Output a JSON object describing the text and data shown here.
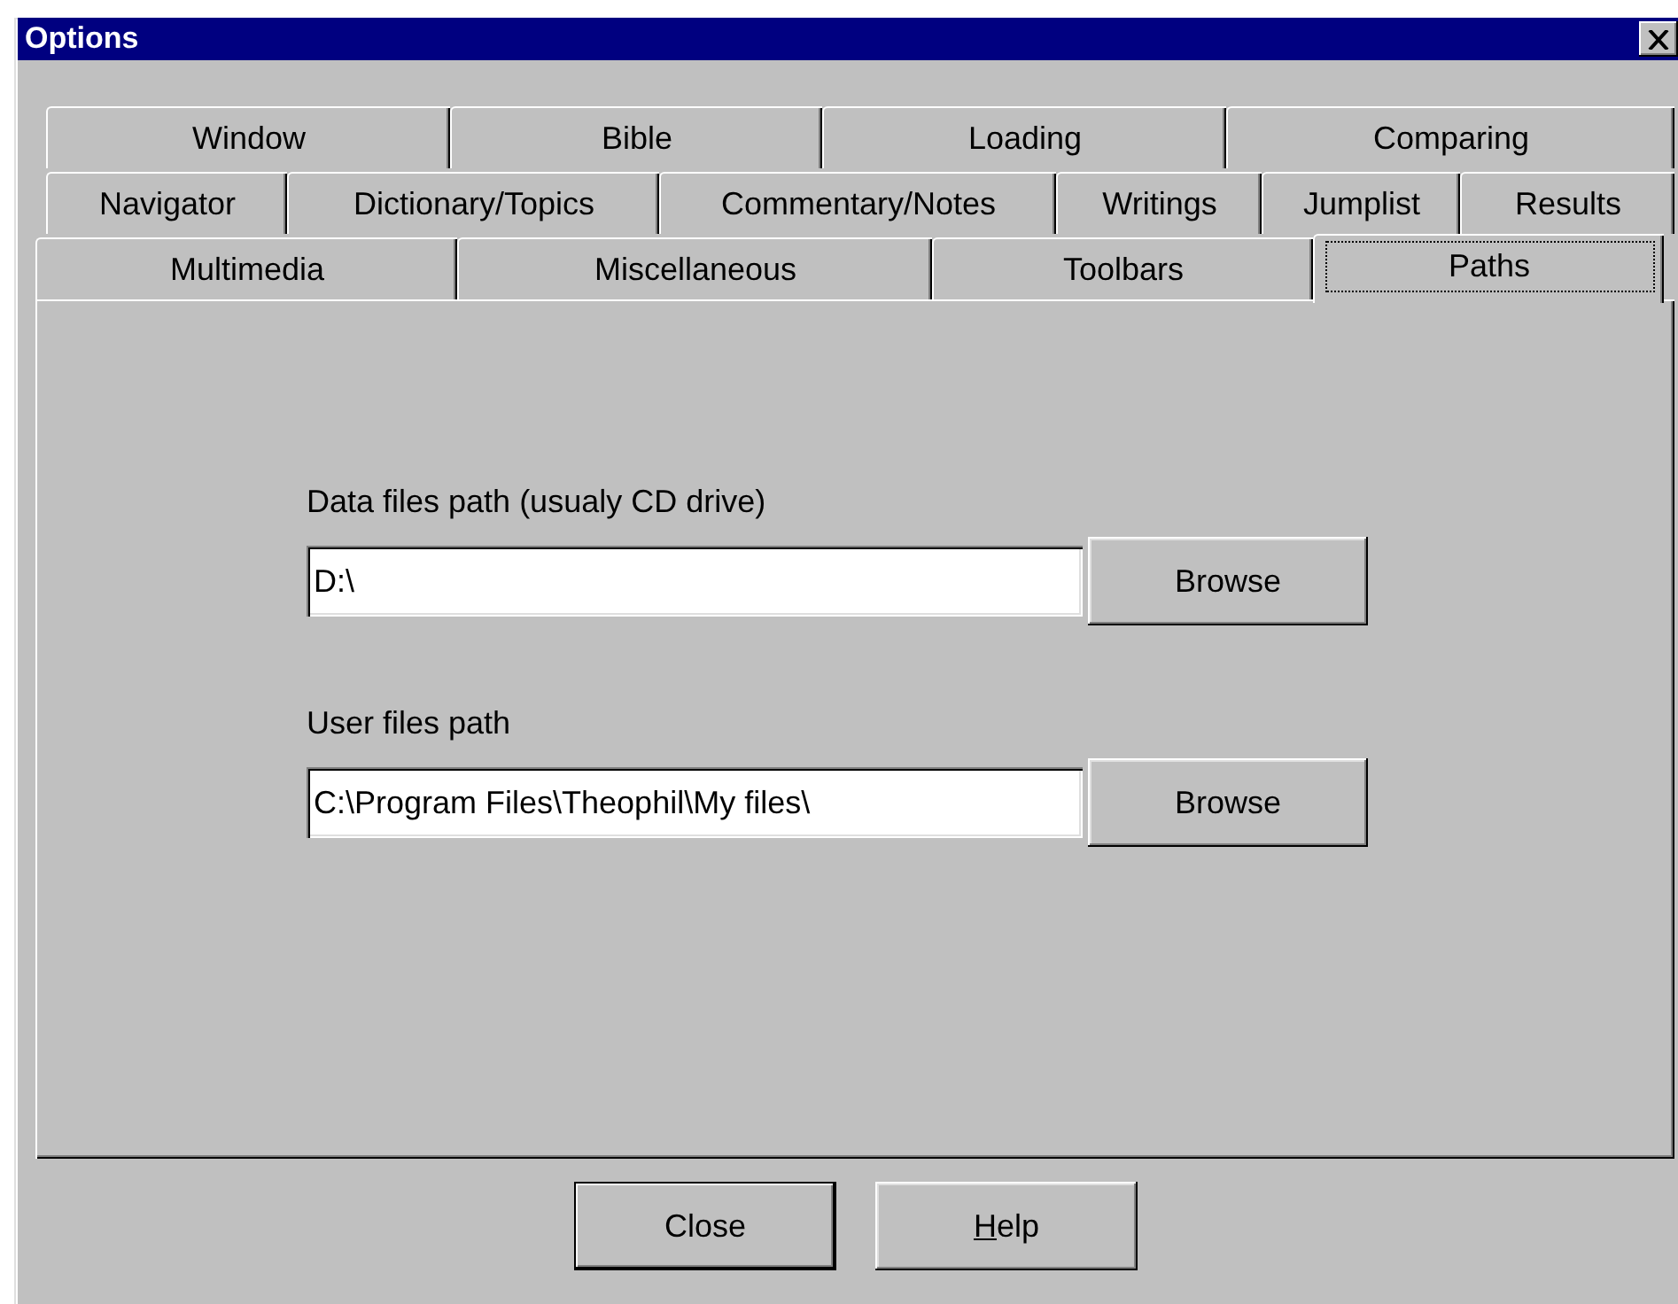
{
  "window": {
    "title": "Options"
  },
  "tab_rows": [
    [
      {
        "label": "Window",
        "selected": false
      },
      {
        "label": "Bible",
        "selected": false
      },
      {
        "label": "Loading",
        "selected": false
      },
      {
        "label": "Comparing",
        "selected": false
      }
    ],
    [
      {
        "label": "Navigator",
        "selected": false
      },
      {
        "label": "Dictionary/Topics",
        "selected": false
      },
      {
        "label": "Commentary/Notes",
        "selected": false
      },
      {
        "label": "Writings",
        "selected": false
      },
      {
        "label": "Jumplist",
        "selected": false
      },
      {
        "label": "Results",
        "selected": false
      }
    ],
    [
      {
        "label": "Multimedia",
        "selected": false
      },
      {
        "label": "Miscellaneous",
        "selected": false
      },
      {
        "label": "Toolbars",
        "selected": false
      },
      {
        "label": "Paths",
        "selected": true
      }
    ]
  ],
  "fields": [
    {
      "label": "Data files path (usualy CD drive)",
      "value": "D:\\",
      "button": "Browse"
    },
    {
      "label": "User files path",
      "value": "C:\\Program Files\\Theophil\\My files\\",
      "button": "Browse"
    }
  ],
  "buttons": [
    {
      "label": "Close",
      "default": true
    },
    {
      "mnemonic": "H",
      "label_rest": "elp",
      "default": false
    }
  ]
}
